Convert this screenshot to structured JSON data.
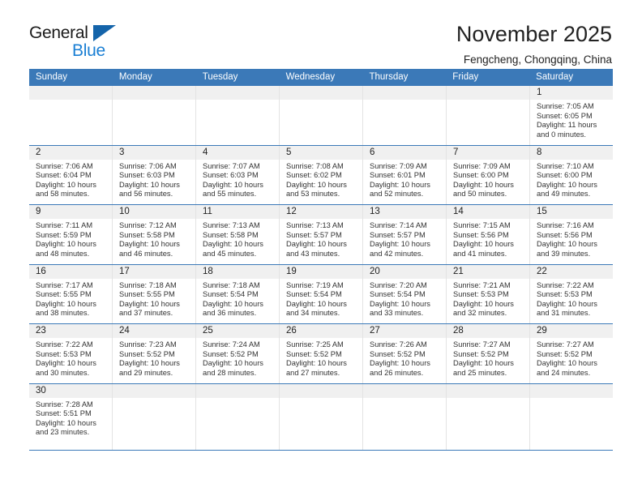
{
  "logo": {
    "word_top": "General",
    "word_bottom": "Blue",
    "triangle_icon": "triangle-icon",
    "brand_blue": "#1a7fd4",
    "brand_dark_blue": "#1464aa"
  },
  "header": {
    "month_title": "November 2025",
    "location": "Fengcheng, Chongqing, China"
  },
  "colors": {
    "header_row_bg": "#3b79b8",
    "daynum_bg": "#f0f0f0",
    "row_border": "#3b79b8",
    "cell_border": "#e3e3e3"
  },
  "calendar": {
    "weekdays": [
      "Sunday",
      "Monday",
      "Tuesday",
      "Wednesday",
      "Thursday",
      "Friday",
      "Saturday"
    ],
    "weeks": [
      [
        {
          "day": "",
          "empty": true
        },
        {
          "day": "",
          "empty": true
        },
        {
          "day": "",
          "empty": true
        },
        {
          "day": "",
          "empty": true
        },
        {
          "day": "",
          "empty": true
        },
        {
          "day": "",
          "empty": true
        },
        {
          "day": "1",
          "sunrise": "Sunrise: 7:05 AM",
          "sunset": "Sunset: 6:05 PM",
          "daylight1": "Daylight: 11 hours",
          "daylight2": "and 0 minutes."
        }
      ],
      [
        {
          "day": "2",
          "sunrise": "Sunrise: 7:06 AM",
          "sunset": "Sunset: 6:04 PM",
          "daylight1": "Daylight: 10 hours",
          "daylight2": "and 58 minutes."
        },
        {
          "day": "3",
          "sunrise": "Sunrise: 7:06 AM",
          "sunset": "Sunset: 6:03 PM",
          "daylight1": "Daylight: 10 hours",
          "daylight2": "and 56 minutes."
        },
        {
          "day": "4",
          "sunrise": "Sunrise: 7:07 AM",
          "sunset": "Sunset: 6:03 PM",
          "daylight1": "Daylight: 10 hours",
          "daylight2": "and 55 minutes."
        },
        {
          "day": "5",
          "sunrise": "Sunrise: 7:08 AM",
          "sunset": "Sunset: 6:02 PM",
          "daylight1": "Daylight: 10 hours",
          "daylight2": "and 53 minutes."
        },
        {
          "day": "6",
          "sunrise": "Sunrise: 7:09 AM",
          "sunset": "Sunset: 6:01 PM",
          "daylight1": "Daylight: 10 hours",
          "daylight2": "and 52 minutes."
        },
        {
          "day": "7",
          "sunrise": "Sunrise: 7:09 AM",
          "sunset": "Sunset: 6:00 PM",
          "daylight1": "Daylight: 10 hours",
          "daylight2": "and 50 minutes."
        },
        {
          "day": "8",
          "sunrise": "Sunrise: 7:10 AM",
          "sunset": "Sunset: 6:00 PM",
          "daylight1": "Daylight: 10 hours",
          "daylight2": "and 49 minutes."
        }
      ],
      [
        {
          "day": "9",
          "sunrise": "Sunrise: 7:11 AM",
          "sunset": "Sunset: 5:59 PM",
          "daylight1": "Daylight: 10 hours",
          "daylight2": "and 48 minutes."
        },
        {
          "day": "10",
          "sunrise": "Sunrise: 7:12 AM",
          "sunset": "Sunset: 5:58 PM",
          "daylight1": "Daylight: 10 hours",
          "daylight2": "and 46 minutes."
        },
        {
          "day": "11",
          "sunrise": "Sunrise: 7:13 AM",
          "sunset": "Sunset: 5:58 PM",
          "daylight1": "Daylight: 10 hours",
          "daylight2": "and 45 minutes."
        },
        {
          "day": "12",
          "sunrise": "Sunrise: 7:13 AM",
          "sunset": "Sunset: 5:57 PM",
          "daylight1": "Daylight: 10 hours",
          "daylight2": "and 43 minutes."
        },
        {
          "day": "13",
          "sunrise": "Sunrise: 7:14 AM",
          "sunset": "Sunset: 5:57 PM",
          "daylight1": "Daylight: 10 hours",
          "daylight2": "and 42 minutes."
        },
        {
          "day": "14",
          "sunrise": "Sunrise: 7:15 AM",
          "sunset": "Sunset: 5:56 PM",
          "daylight1": "Daylight: 10 hours",
          "daylight2": "and 41 minutes."
        },
        {
          "day": "15",
          "sunrise": "Sunrise: 7:16 AM",
          "sunset": "Sunset: 5:56 PM",
          "daylight1": "Daylight: 10 hours",
          "daylight2": "and 39 minutes."
        }
      ],
      [
        {
          "day": "16",
          "sunrise": "Sunrise: 7:17 AM",
          "sunset": "Sunset: 5:55 PM",
          "daylight1": "Daylight: 10 hours",
          "daylight2": "and 38 minutes."
        },
        {
          "day": "17",
          "sunrise": "Sunrise: 7:18 AM",
          "sunset": "Sunset: 5:55 PM",
          "daylight1": "Daylight: 10 hours",
          "daylight2": "and 37 minutes."
        },
        {
          "day": "18",
          "sunrise": "Sunrise: 7:18 AM",
          "sunset": "Sunset: 5:54 PM",
          "daylight1": "Daylight: 10 hours",
          "daylight2": "and 36 minutes."
        },
        {
          "day": "19",
          "sunrise": "Sunrise: 7:19 AM",
          "sunset": "Sunset: 5:54 PM",
          "daylight1": "Daylight: 10 hours",
          "daylight2": "and 34 minutes."
        },
        {
          "day": "20",
          "sunrise": "Sunrise: 7:20 AM",
          "sunset": "Sunset: 5:54 PM",
          "daylight1": "Daylight: 10 hours",
          "daylight2": "and 33 minutes."
        },
        {
          "day": "21",
          "sunrise": "Sunrise: 7:21 AM",
          "sunset": "Sunset: 5:53 PM",
          "daylight1": "Daylight: 10 hours",
          "daylight2": "and 32 minutes."
        },
        {
          "day": "22",
          "sunrise": "Sunrise: 7:22 AM",
          "sunset": "Sunset: 5:53 PM",
          "daylight1": "Daylight: 10 hours",
          "daylight2": "and 31 minutes."
        }
      ],
      [
        {
          "day": "23",
          "sunrise": "Sunrise: 7:22 AM",
          "sunset": "Sunset: 5:53 PM",
          "daylight1": "Daylight: 10 hours",
          "daylight2": "and 30 minutes."
        },
        {
          "day": "24",
          "sunrise": "Sunrise: 7:23 AM",
          "sunset": "Sunset: 5:52 PM",
          "daylight1": "Daylight: 10 hours",
          "daylight2": "and 29 minutes."
        },
        {
          "day": "25",
          "sunrise": "Sunrise: 7:24 AM",
          "sunset": "Sunset: 5:52 PM",
          "daylight1": "Daylight: 10 hours",
          "daylight2": "and 28 minutes."
        },
        {
          "day": "26",
          "sunrise": "Sunrise: 7:25 AM",
          "sunset": "Sunset: 5:52 PM",
          "daylight1": "Daylight: 10 hours",
          "daylight2": "and 27 minutes."
        },
        {
          "day": "27",
          "sunrise": "Sunrise: 7:26 AM",
          "sunset": "Sunset: 5:52 PM",
          "daylight1": "Daylight: 10 hours",
          "daylight2": "and 26 minutes."
        },
        {
          "day": "28",
          "sunrise": "Sunrise: 7:27 AM",
          "sunset": "Sunset: 5:52 PM",
          "daylight1": "Daylight: 10 hours",
          "daylight2": "and 25 minutes."
        },
        {
          "day": "29",
          "sunrise": "Sunrise: 7:27 AM",
          "sunset": "Sunset: 5:52 PM",
          "daylight1": "Daylight: 10 hours",
          "daylight2": "and 24 minutes."
        }
      ],
      [
        {
          "day": "30",
          "sunrise": "Sunrise: 7:28 AM",
          "sunset": "Sunset: 5:51 PM",
          "daylight1": "Daylight: 10 hours",
          "daylight2": "and 23 minutes."
        },
        {
          "day": "",
          "empty": true
        },
        {
          "day": "",
          "empty": true
        },
        {
          "day": "",
          "empty": true
        },
        {
          "day": "",
          "empty": true
        },
        {
          "day": "",
          "empty": true
        },
        {
          "day": "",
          "empty": true
        }
      ]
    ]
  }
}
